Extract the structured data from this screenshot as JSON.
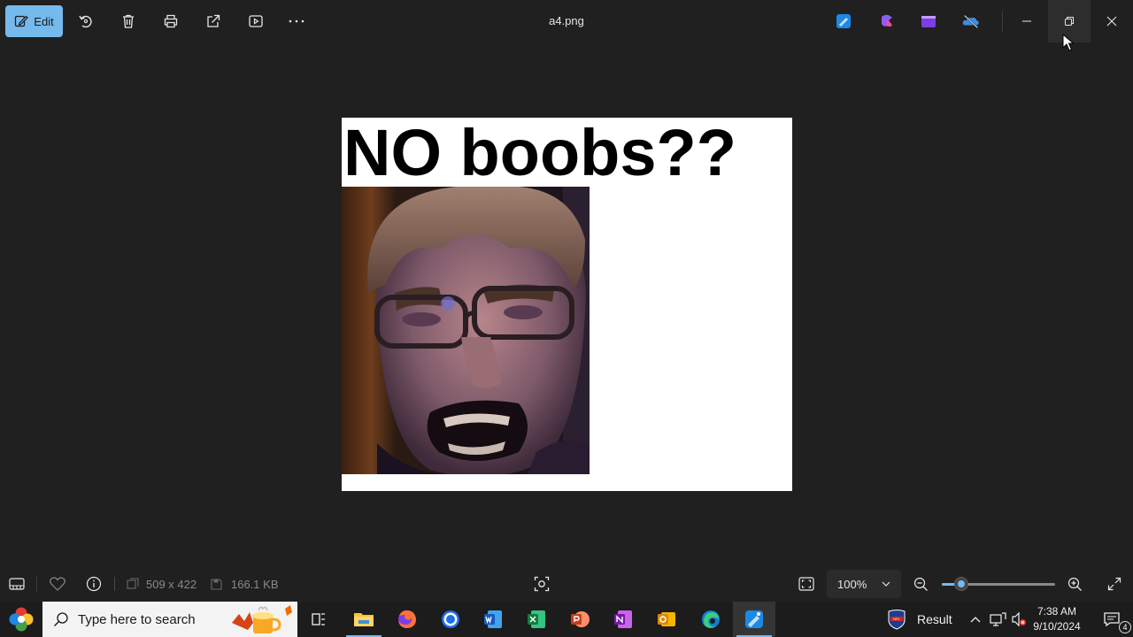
{
  "toolbar": {
    "edit_label": "Edit",
    "file_name": "a4.png",
    "accent_color": "#76b9ed",
    "icons": [
      "edit-icon",
      "rotate-icon",
      "delete-icon",
      "print-icon",
      "share-icon",
      "slideshow-icon",
      "more-icon"
    ],
    "app_icons": [
      "photos-editor-icon",
      "clipchamp-icon",
      "movie-maker-icon",
      "onedrive-icon"
    ]
  },
  "image": {
    "caption": "NO boobs??",
    "photo_icon": "face-photo"
  },
  "statusbar": {
    "dimensions": "509 x 422",
    "file_size": "166.1 KB",
    "zoom": "100%",
    "zoom_fraction": 0.17
  },
  "taskbar": {
    "search_placeholder": "Type here to search",
    "weather_label": "Result",
    "time": "7:38 AM",
    "date": "9/10/2024",
    "notification_count": "4"
  }
}
